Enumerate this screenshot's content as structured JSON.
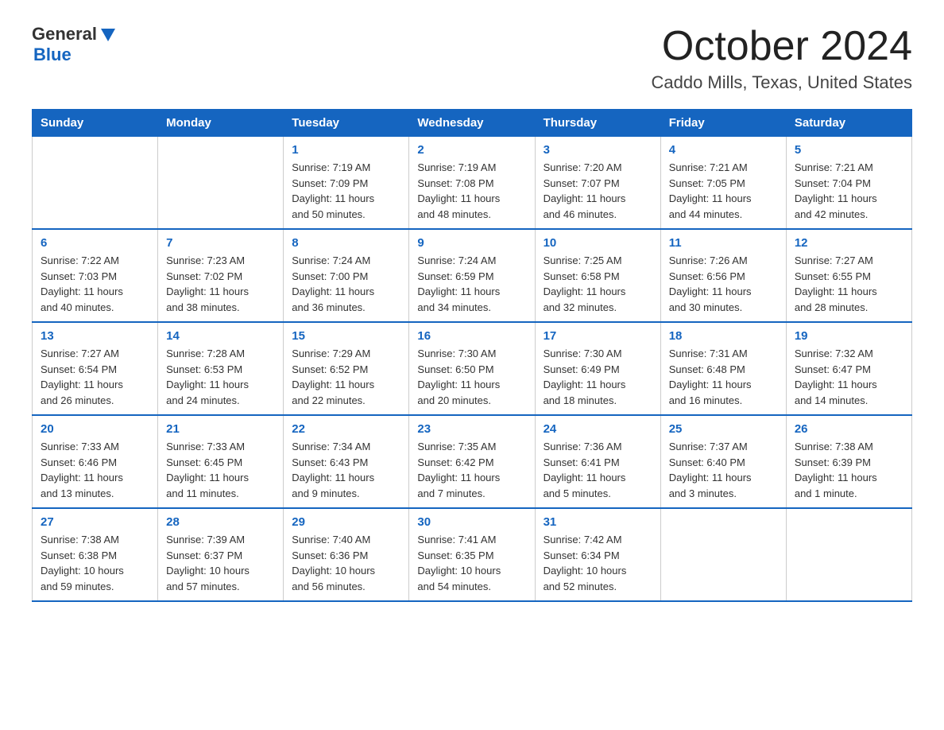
{
  "logo": {
    "general": "General",
    "blue": "Blue"
  },
  "title": "October 2024",
  "subtitle": "Caddo Mills, Texas, United States",
  "days_of_week": [
    "Sunday",
    "Monday",
    "Tuesday",
    "Wednesday",
    "Thursday",
    "Friday",
    "Saturday"
  ],
  "weeks": [
    [
      {
        "day": "",
        "info": ""
      },
      {
        "day": "",
        "info": ""
      },
      {
        "day": "1",
        "info": "Sunrise: 7:19 AM\nSunset: 7:09 PM\nDaylight: 11 hours\nand 50 minutes."
      },
      {
        "day": "2",
        "info": "Sunrise: 7:19 AM\nSunset: 7:08 PM\nDaylight: 11 hours\nand 48 minutes."
      },
      {
        "day": "3",
        "info": "Sunrise: 7:20 AM\nSunset: 7:07 PM\nDaylight: 11 hours\nand 46 minutes."
      },
      {
        "day": "4",
        "info": "Sunrise: 7:21 AM\nSunset: 7:05 PM\nDaylight: 11 hours\nand 44 minutes."
      },
      {
        "day": "5",
        "info": "Sunrise: 7:21 AM\nSunset: 7:04 PM\nDaylight: 11 hours\nand 42 minutes."
      }
    ],
    [
      {
        "day": "6",
        "info": "Sunrise: 7:22 AM\nSunset: 7:03 PM\nDaylight: 11 hours\nand 40 minutes."
      },
      {
        "day": "7",
        "info": "Sunrise: 7:23 AM\nSunset: 7:02 PM\nDaylight: 11 hours\nand 38 minutes."
      },
      {
        "day": "8",
        "info": "Sunrise: 7:24 AM\nSunset: 7:00 PM\nDaylight: 11 hours\nand 36 minutes."
      },
      {
        "day": "9",
        "info": "Sunrise: 7:24 AM\nSunset: 6:59 PM\nDaylight: 11 hours\nand 34 minutes."
      },
      {
        "day": "10",
        "info": "Sunrise: 7:25 AM\nSunset: 6:58 PM\nDaylight: 11 hours\nand 32 minutes."
      },
      {
        "day": "11",
        "info": "Sunrise: 7:26 AM\nSunset: 6:56 PM\nDaylight: 11 hours\nand 30 minutes."
      },
      {
        "day": "12",
        "info": "Sunrise: 7:27 AM\nSunset: 6:55 PM\nDaylight: 11 hours\nand 28 minutes."
      }
    ],
    [
      {
        "day": "13",
        "info": "Sunrise: 7:27 AM\nSunset: 6:54 PM\nDaylight: 11 hours\nand 26 minutes."
      },
      {
        "day": "14",
        "info": "Sunrise: 7:28 AM\nSunset: 6:53 PM\nDaylight: 11 hours\nand 24 minutes."
      },
      {
        "day": "15",
        "info": "Sunrise: 7:29 AM\nSunset: 6:52 PM\nDaylight: 11 hours\nand 22 minutes."
      },
      {
        "day": "16",
        "info": "Sunrise: 7:30 AM\nSunset: 6:50 PM\nDaylight: 11 hours\nand 20 minutes."
      },
      {
        "day": "17",
        "info": "Sunrise: 7:30 AM\nSunset: 6:49 PM\nDaylight: 11 hours\nand 18 minutes."
      },
      {
        "day": "18",
        "info": "Sunrise: 7:31 AM\nSunset: 6:48 PM\nDaylight: 11 hours\nand 16 minutes."
      },
      {
        "day": "19",
        "info": "Sunrise: 7:32 AM\nSunset: 6:47 PM\nDaylight: 11 hours\nand 14 minutes."
      }
    ],
    [
      {
        "day": "20",
        "info": "Sunrise: 7:33 AM\nSunset: 6:46 PM\nDaylight: 11 hours\nand 13 minutes."
      },
      {
        "day": "21",
        "info": "Sunrise: 7:33 AM\nSunset: 6:45 PM\nDaylight: 11 hours\nand 11 minutes."
      },
      {
        "day": "22",
        "info": "Sunrise: 7:34 AM\nSunset: 6:43 PM\nDaylight: 11 hours\nand 9 minutes."
      },
      {
        "day": "23",
        "info": "Sunrise: 7:35 AM\nSunset: 6:42 PM\nDaylight: 11 hours\nand 7 minutes."
      },
      {
        "day": "24",
        "info": "Sunrise: 7:36 AM\nSunset: 6:41 PM\nDaylight: 11 hours\nand 5 minutes."
      },
      {
        "day": "25",
        "info": "Sunrise: 7:37 AM\nSunset: 6:40 PM\nDaylight: 11 hours\nand 3 minutes."
      },
      {
        "day": "26",
        "info": "Sunrise: 7:38 AM\nSunset: 6:39 PM\nDaylight: 11 hours\nand 1 minute."
      }
    ],
    [
      {
        "day": "27",
        "info": "Sunrise: 7:38 AM\nSunset: 6:38 PM\nDaylight: 10 hours\nand 59 minutes."
      },
      {
        "day": "28",
        "info": "Sunrise: 7:39 AM\nSunset: 6:37 PM\nDaylight: 10 hours\nand 57 minutes."
      },
      {
        "day": "29",
        "info": "Sunrise: 7:40 AM\nSunset: 6:36 PM\nDaylight: 10 hours\nand 56 minutes."
      },
      {
        "day": "30",
        "info": "Sunrise: 7:41 AM\nSunset: 6:35 PM\nDaylight: 10 hours\nand 54 minutes."
      },
      {
        "day": "31",
        "info": "Sunrise: 7:42 AM\nSunset: 6:34 PM\nDaylight: 10 hours\nand 52 minutes."
      },
      {
        "day": "",
        "info": ""
      },
      {
        "day": "",
        "info": ""
      }
    ]
  ]
}
